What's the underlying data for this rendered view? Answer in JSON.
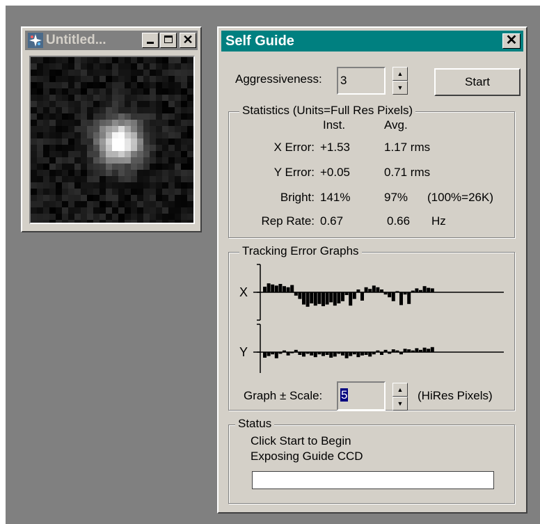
{
  "image_window": {
    "title": "Untitled...",
    "minimize": "_",
    "maximize": "□",
    "close": "✕"
  },
  "self_guide": {
    "title": "Self Guide",
    "close": "✕",
    "aggressiveness_label": "Aggressiveness:",
    "aggressiveness_value": "3",
    "start_label": "Start",
    "statistics": {
      "legend": "Statistics (Units=Full Res Pixels)",
      "col_inst": "Inst.",
      "col_avg": "Avg.",
      "rows": [
        {
          "label": "X Error:",
          "inst": "+1.53",
          "avg": "1.17 rms",
          "extra": ""
        },
        {
          "label": "Y Error:",
          "inst": "+0.05",
          "avg": "0.71 rms",
          "extra": ""
        },
        {
          "label": "Bright:",
          "inst": "141%",
          "avg": "97%",
          "extra": "(100%=26K)"
        },
        {
          "label": "Rep Rate:",
          "inst": "0.67",
          "avg": "0.66",
          "extra": "Hz"
        }
      ]
    },
    "graphs": {
      "legend": "Tracking Error Graphs",
      "x_label": "X",
      "y_label": "Y",
      "scale_label": "Graph ± Scale:",
      "scale_value": "5",
      "scale_units": "(HiRes Pixels)"
    },
    "status": {
      "legend": "Status",
      "line1": "Click Start to Begin",
      "line2": "Exposing Guide CCD",
      "progress": 0
    }
  },
  "chart_data": [
    {
      "type": "bar",
      "series": [
        {
          "name": "X",
          "values": [
            1.0,
            1.6,
            1.4,
            1.2,
            1.5,
            1.1,
            0.9,
            1.3,
            -0.6,
            -1.2,
            -2.2,
            -2.6,
            -2.0,
            -2.4,
            -2.1,
            -2.5,
            -2.2,
            -1.8,
            -2.4,
            -2.0,
            -1.6,
            -0.5,
            -2.4,
            -1.2,
            0.5,
            -1.5,
            0.9,
            0.6,
            1.2,
            0.9,
            0.5,
            -0.4,
            -0.9,
            -1.6,
            0.2,
            -2.3,
            -0.4,
            -2.1,
            0.3,
            0.7,
            0.4,
            1.1,
            0.8,
            0.7
          ]
        }
      ],
      "ylim": [
        -5,
        5
      ]
    },
    {
      "type": "bar",
      "series": [
        {
          "name": "Y",
          "values": [
            -1.0,
            -0.7,
            -0.4,
            -1.1,
            -0.3,
            0.3,
            -0.6,
            -0.2,
            0.4,
            -0.5,
            -0.8,
            -0.3,
            -0.6,
            -0.9,
            -0.4,
            -0.7,
            -0.5,
            -1.0,
            -0.8,
            -0.3,
            -0.6,
            -1.1,
            -0.7,
            -0.4,
            -0.9,
            -0.6,
            -0.5,
            -0.8,
            -0.4,
            0.3,
            -0.5,
            0.4,
            -0.3,
            0.5,
            0.3,
            -0.4,
            0.6,
            0.5,
            0.3,
            0.7,
            0.4,
            0.8,
            0.6,
            0.9
          ]
        }
      ],
      "ylim": [
        -5,
        5
      ]
    }
  ]
}
